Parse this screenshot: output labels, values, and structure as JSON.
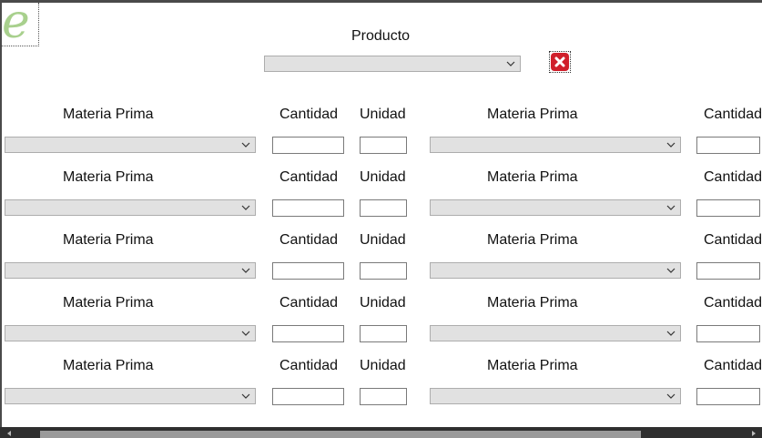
{
  "product": {
    "label": "Producto",
    "selected": ""
  },
  "row_labels": {
    "materia_prima": "Materia Prima",
    "cantidad": "Cantidad",
    "unidad": "Unidad"
  },
  "rows": [
    {
      "left_select": "",
      "left_cantidad": "",
      "left_unidad": "",
      "right_select": "",
      "right_cantidad": ""
    },
    {
      "left_select": "",
      "left_cantidad": "",
      "left_unidad": "",
      "right_select": "",
      "right_cantidad": ""
    },
    {
      "left_select": "",
      "left_cantidad": "",
      "left_unidad": "",
      "right_select": "",
      "right_cantidad": ""
    },
    {
      "left_select": "",
      "left_cantidad": "",
      "left_unidad": "",
      "right_select": "",
      "right_cantidad": ""
    },
    {
      "left_select": "",
      "left_cantidad": "",
      "left_unidad": "",
      "right_select": "",
      "right_cantidad": ""
    }
  ],
  "logo": {
    "glyph": "e",
    "icon": "app-logo-icon",
    "color": "#a8d08d"
  },
  "close_icon": {
    "icon": "close-icon",
    "color": "#d01f2b"
  }
}
